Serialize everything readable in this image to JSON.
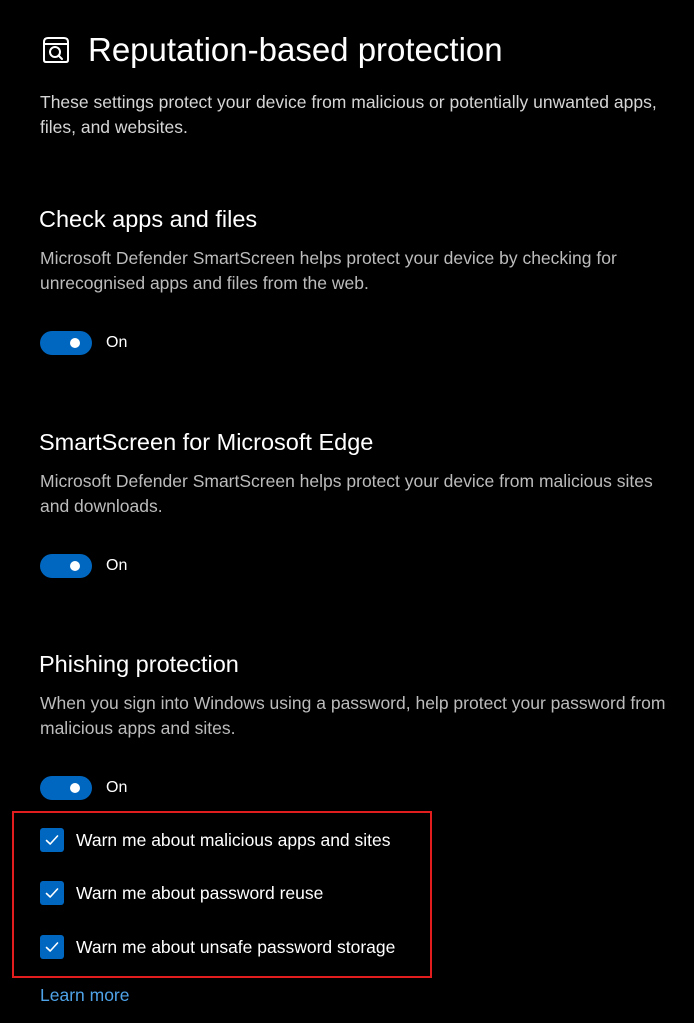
{
  "header": {
    "icon": "reputation-shield-search-icon",
    "title": "Reputation-based protection",
    "description": "These settings protect your device from malicious or potentially unwanted apps, files, and websites."
  },
  "sections": [
    {
      "heading": "Check apps and files",
      "description": "Microsoft Defender SmartScreen helps protect your device by checking for unrecognised apps and files from the web.",
      "toggle_state": "On",
      "enabled": true
    },
    {
      "heading": "SmartScreen for Microsoft Edge",
      "description": "Microsoft Defender SmartScreen helps protect your device from malicious sites and downloads.",
      "toggle_state": "On",
      "enabled": true
    },
    {
      "heading": "Phishing protection",
      "description": "When you sign into Windows using a password, help protect your password from malicious apps and sites.",
      "toggle_state": "On",
      "enabled": true,
      "options": [
        {
          "label": "Warn me about malicious apps and sites",
          "checked": true
        },
        {
          "label": "Warn me about password reuse",
          "checked": true
        },
        {
          "label": "Warn me about unsafe password storage",
          "checked": true
        }
      ]
    }
  ],
  "links": {
    "learn_more": "Learn more"
  },
  "colors": {
    "background": "#000000",
    "accent": "#0067c0",
    "link": "#4fa3e8",
    "highlight_border": "#e21d1d"
  }
}
